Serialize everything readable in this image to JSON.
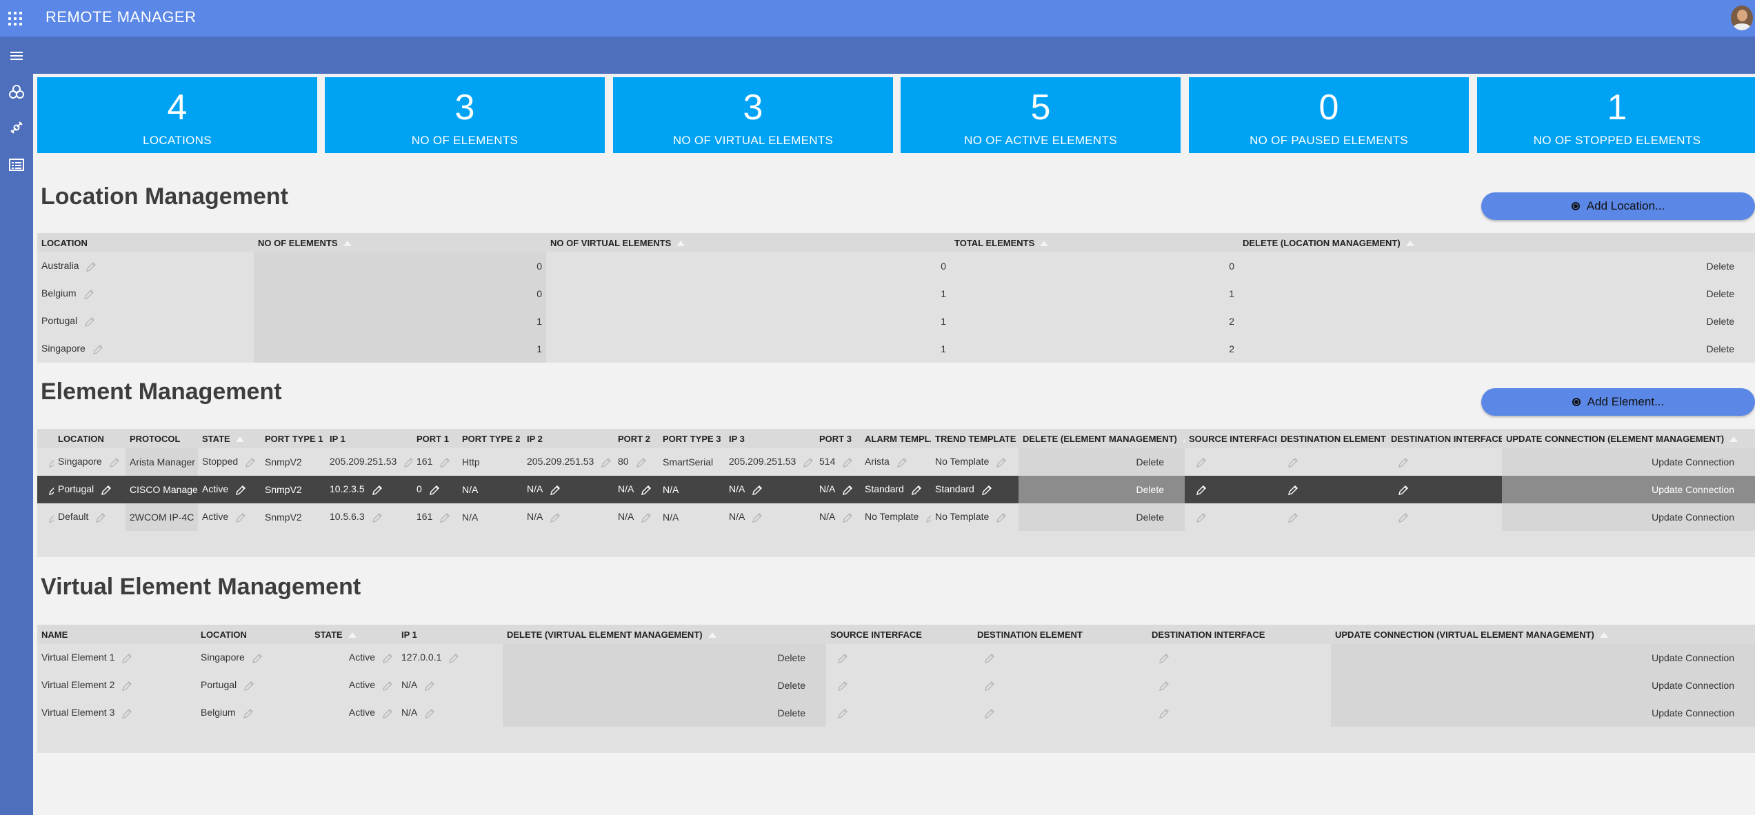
{
  "app": {
    "title": "REMOTE MANAGER"
  },
  "kpis": [
    {
      "value": "4",
      "label": "LOCATIONS"
    },
    {
      "value": "3",
      "label": "NO OF ELEMENTS"
    },
    {
      "value": "3",
      "label": "NO OF VIRTUAL ELEMENTS"
    },
    {
      "value": "5",
      "label": "NO OF ACTIVE ELEMENTS"
    },
    {
      "value": "0",
      "label": "NO OF PAUSED ELEMENTS"
    },
    {
      "value": "1",
      "label": "NO OF STOPPED ELEMENTS"
    }
  ],
  "location_management": {
    "title": "Location Management",
    "add_label": "Add Location...",
    "columns": [
      "LOCATION",
      "NO OF ELEMENTS",
      "NO OF VIRTUAL ELEMENTS",
      "TOTAL ELEMENTS",
      "DELETE (LOCATION MANAGEMENT)"
    ],
    "rows": [
      {
        "location": "Australia",
        "elements": "0",
        "virtual": "0",
        "total": "0",
        "delete": "Delete"
      },
      {
        "location": "Belgium",
        "elements": "0",
        "virtual": "1",
        "total": "1",
        "delete": "Delete"
      },
      {
        "location": "Portugal",
        "elements": "1",
        "virtual": "1",
        "total": "2",
        "delete": "Delete"
      },
      {
        "location": "Singapore",
        "elements": "1",
        "virtual": "1",
        "total": "2",
        "delete": "Delete"
      }
    ]
  },
  "element_management": {
    "title": "Element Management",
    "add_label": "Add Element...",
    "columns": [
      "LOCATION",
      "PROTOCOL",
      "STATE",
      "PORT TYPE 1",
      "IP 1",
      "PORT 1",
      "PORT TYPE 2",
      "IP 2",
      "PORT 2",
      "PORT TYPE 3",
      "IP 3",
      "PORT 3",
      "ALARM TEMPLATE",
      "TREND TEMPLATE",
      "DELETE (ELEMENT MANAGEMENT)",
      "SOURCE INTERFACE",
      "DESTINATION ELEMENT",
      "DESTINATION INTERFACE",
      "UPDATE CONNECTION (ELEMENT MANAGEMENT)"
    ],
    "rows": [
      {
        "location": "Singapore",
        "protocol": "Arista Manager",
        "state": "Stopped",
        "pt1": "SnmpV2",
        "ip1": "205.209.251.53",
        "port1": "161",
        "pt2": "Http",
        "ip2": "205.209.251.53",
        "port2": "80",
        "pt3": "SmartSerial",
        "ip3": "205.209.251.53",
        "port3": "514",
        "alarm": "Arista",
        "trend": "No Template",
        "delete": "Delete",
        "update": "Update Connection"
      },
      {
        "location": "Portugal",
        "protocol": "CISCO Manager",
        "state": "Active",
        "pt1": "SnmpV2",
        "ip1": "10.2.3.5",
        "port1": "0",
        "pt2": "N/A",
        "ip2": "N/A",
        "port2": "N/A",
        "pt3": "N/A",
        "ip3": "N/A",
        "port3": "N/A",
        "alarm": "Standard",
        "trend": "Standard",
        "delete": "Delete",
        "update": "Update Connection"
      },
      {
        "location": "Default",
        "protocol": "2WCOM IP-4C",
        "state": "Active",
        "pt1": "SnmpV2",
        "ip1": "10.5.6.3",
        "port1": "161",
        "pt2": "N/A",
        "ip2": "N/A",
        "port2": "N/A",
        "pt3": "N/A",
        "ip3": "N/A",
        "port3": "N/A",
        "alarm": "No Template",
        "trend": "No Template",
        "delete": "Delete",
        "update": "Update Connection"
      }
    ]
  },
  "virtual_element_management": {
    "title": "Virtual Element Management",
    "columns": [
      "NAME",
      "LOCATION",
      "STATE",
      "IP 1",
      "DELETE (VIRTUAL ELEMENT MANAGEMENT)",
      "SOURCE INTERFACE",
      "DESTINATION ELEMENT",
      "DESTINATION INTERFACE",
      "UPDATE CONNECTION (VIRTUAL ELEMENT MANAGEMENT)"
    ],
    "rows": [
      {
        "name": "Virtual Element 1",
        "location": "Singapore",
        "state": "Active",
        "ip1": "127.0.0.1",
        "delete": "Delete",
        "update": "Update Connection"
      },
      {
        "name": "Virtual Element 2",
        "location": "Portugal",
        "state": "Active",
        "ip1": "N/A",
        "delete": "Delete",
        "update": "Update Connection"
      },
      {
        "name": "Virtual Element 3",
        "location": "Belgium",
        "state": "Active",
        "ip1": "N/A",
        "delete": "Delete",
        "update": "Update Connection"
      }
    ]
  },
  "colors": {
    "topbar": "#5b87e6",
    "sidebar": "#4d6fbc",
    "kpi": "#00a2f3",
    "selected_row": "#444444"
  },
  "icons": [
    "apps-grid-icon",
    "menu-icon",
    "locations-icon",
    "elements-icon",
    "list-icon",
    "edit-icon",
    "sort-ascending-icon"
  ]
}
